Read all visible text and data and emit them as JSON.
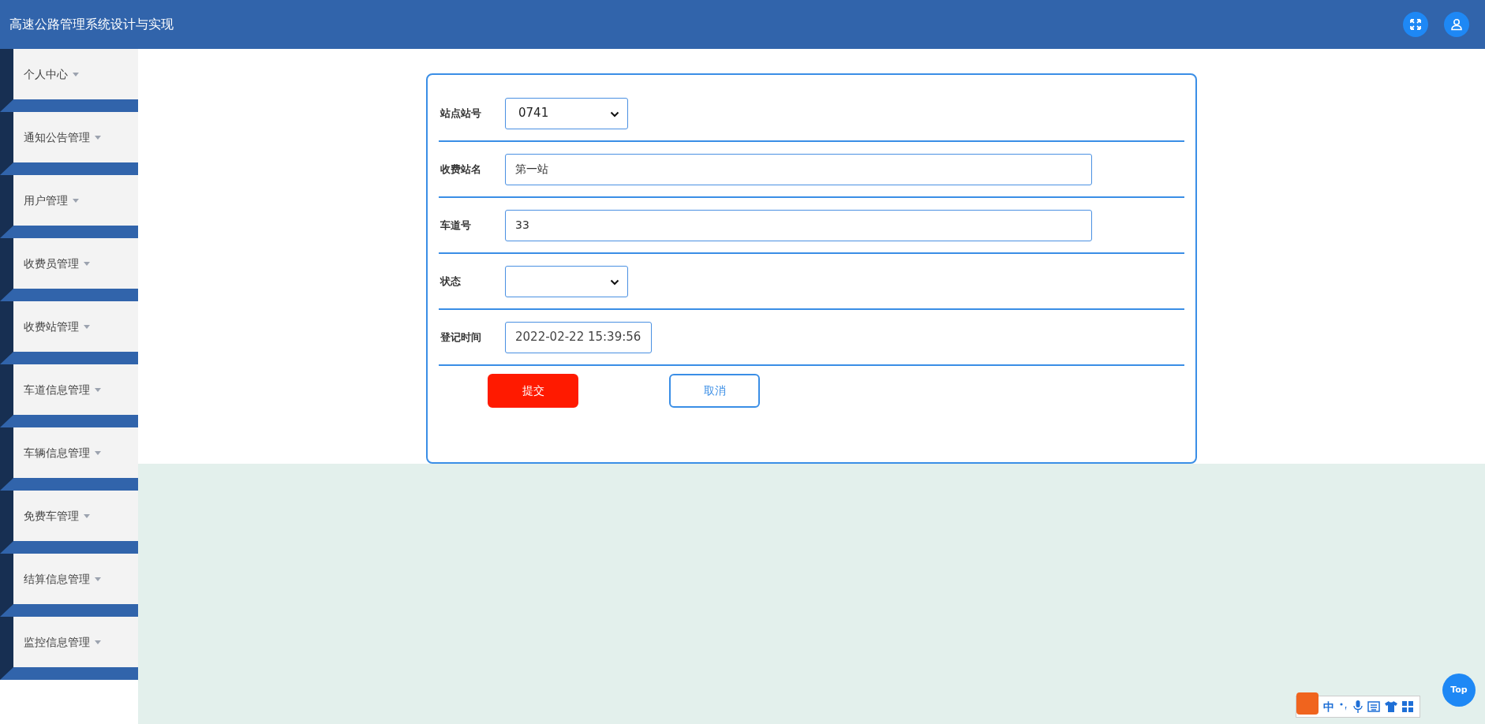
{
  "header": {
    "title": "高速公路管理系统设计与实现"
  },
  "sidebar": {
    "items": [
      {
        "label": "个人中心"
      },
      {
        "label": "通知公告管理"
      },
      {
        "label": "用户管理"
      },
      {
        "label": "收费员管理"
      },
      {
        "label": "收费站管理"
      },
      {
        "label": "车道信息管理"
      },
      {
        "label": "车辆信息管理"
      },
      {
        "label": "免费车管理"
      },
      {
        "label": "结算信息管理"
      },
      {
        "label": "监控信息管理"
      }
    ]
  },
  "form": {
    "fields": [
      {
        "label": "站点站号",
        "kind": "select",
        "value": "0741"
      },
      {
        "label": "收费站名",
        "kind": "text",
        "value": "第一站"
      },
      {
        "label": "车道号",
        "kind": "text",
        "value": "33"
      },
      {
        "label": "状态",
        "kind": "select"
      },
      {
        "label": "登记时间",
        "kind": "datetime",
        "value": "2022-02-22 15:39:56"
      }
    ],
    "buttons": [
      {
        "label": "提交",
        "kind": "primary"
      },
      {
        "label": "取消",
        "kind": "outline"
      }
    ]
  },
  "back_to_top": {
    "label": "Top"
  },
  "ime_toolbar": {
    "mode": "中"
  }
}
